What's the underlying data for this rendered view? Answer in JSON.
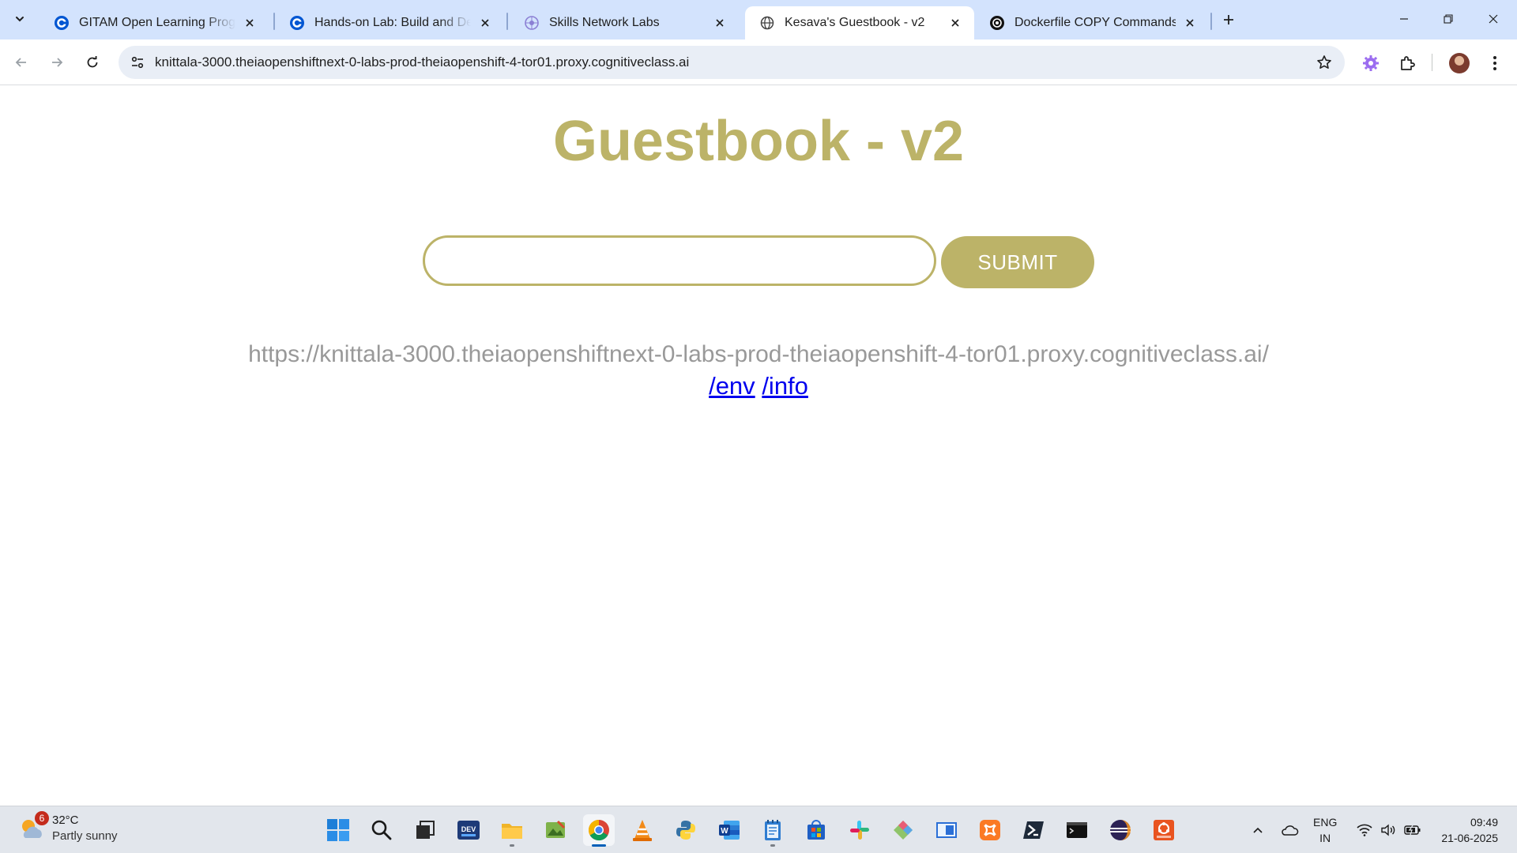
{
  "browser": {
    "tabs": [
      {
        "title": "GITAM Open Learning Program",
        "active": false
      },
      {
        "title": "Hands-on Lab: Build and Deplo",
        "active": false
      },
      {
        "title": "Skills Network Labs",
        "active": false
      },
      {
        "title": "Kesava's Guestbook - v2",
        "active": true
      },
      {
        "title": "Dockerfile COPY Commands",
        "active": false
      }
    ],
    "address_url": "knittala-3000.theiaopenshiftnext-0-labs-prod-theiaopenshift-4-tor01.proxy.cognitiveclass.ai"
  },
  "page": {
    "title": "Guestbook - v2",
    "input_value": "",
    "submit_label": "SUBMIT",
    "host_address": "https://knittala-3000.theiaopenshiftnext-0-labs-prod-theiaopenshift-4-tor01.proxy.cognitiveclass.ai/",
    "link_env": "/env",
    "link_info": "/info"
  },
  "taskbar": {
    "weather_temp": "32°C",
    "weather_desc": "Partly sunny",
    "weather_badge": "6",
    "lang_top": "ENG",
    "lang_bottom": "IN",
    "time": "09:49",
    "date": "21-06-2025",
    "apps": [
      "windows-start",
      "search",
      "task-view",
      "dev-home",
      "file-explorer",
      "photos",
      "chrome",
      "vlc",
      "python",
      "word",
      "notepad",
      "microsoft-store",
      "slack",
      "git-gui",
      "remote-desktop",
      "xampp",
      "powershell",
      "terminal",
      "eclipse",
      "ubuntu"
    ]
  },
  "colors": {
    "accent": "#bcb368",
    "tabstrip": "#d3e3fd",
    "link": "#0000ee",
    "host_text": "#999999"
  }
}
